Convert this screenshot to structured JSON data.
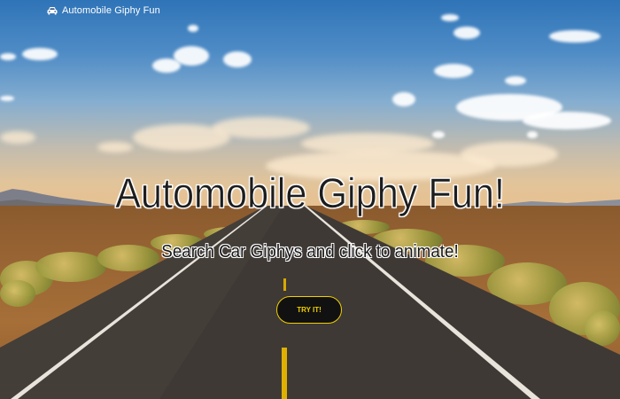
{
  "navbar": {
    "brand_icon": "car-icon",
    "brand_text": "Automobile Giphy Fun"
  },
  "hero": {
    "title": "Automobile Giphy Fun!",
    "subtitle": "Search Car Giphys and click to animate!",
    "cta_label": "TRY IT!"
  },
  "colors": {
    "button_background": "#111111",
    "button_accent": "#f0d000",
    "title_text": "#1d1d1d"
  }
}
